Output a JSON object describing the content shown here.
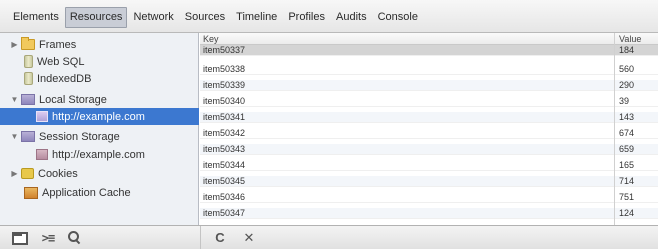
{
  "tabs": [
    {
      "label": "Elements",
      "active": false
    },
    {
      "label": "Resources",
      "active": true
    },
    {
      "label": "Network",
      "active": false
    },
    {
      "label": "Sources",
      "active": false
    },
    {
      "label": "Timeline",
      "active": false
    },
    {
      "label": "Profiles",
      "active": false
    },
    {
      "label": "Audits",
      "active": false
    },
    {
      "label": "Console",
      "active": false
    }
  ],
  "sidebar": {
    "items": [
      {
        "label": "Frames",
        "icon": "folder-icon",
        "expander": "collapsed"
      },
      {
        "label": "Web SQL",
        "icon": "database-icon",
        "expander": "none"
      },
      {
        "label": "IndexedDB",
        "icon": "database-icon",
        "expander": "none"
      },
      {
        "label": "Local Storage",
        "icon": "storage-icon",
        "expander": "expanded"
      },
      {
        "label": "http://example.com",
        "icon": "page-icon",
        "expander": "none",
        "selected": true
      },
      {
        "label": "Session Storage",
        "icon": "storage-icon",
        "expander": "expanded"
      },
      {
        "label": "http://example.com",
        "icon": "page-icon",
        "expander": "none"
      },
      {
        "label": "Cookies",
        "icon": "cookie-icon",
        "expander": "collapsed"
      },
      {
        "label": "Application Cache",
        "icon": "app-cache-icon",
        "expander": "none"
      }
    ]
  },
  "grid": {
    "columns": {
      "key": "Key",
      "value": "Value"
    },
    "rows": [
      {
        "key": "item50337",
        "value": "184"
      },
      {
        "key": "item50338",
        "value": "560"
      },
      {
        "key": "item50339",
        "value": "290"
      },
      {
        "key": "item50340",
        "value": "39"
      },
      {
        "key": "item50341",
        "value": "143"
      },
      {
        "key": "item50342",
        "value": "674"
      },
      {
        "key": "item50343",
        "value": "659"
      },
      {
        "key": "item50344",
        "value": "165"
      },
      {
        "key": "item50345",
        "value": "714"
      },
      {
        "key": "item50346",
        "value": "751"
      },
      {
        "key": "item50347",
        "value": "124"
      }
    ],
    "selected_row": 0
  },
  "statusbar": {
    "left_icons": [
      "dock-icon",
      "console-drawer-icon",
      "search-icon"
    ],
    "right_icons": [
      "refresh-icon",
      "clear-icon"
    ],
    "console_glyph": ">≡",
    "refresh_glyph": "C",
    "clear_glyph": "✕"
  },
  "colors": {
    "selection_blue": "#3c78d0",
    "active_tab": "#c9cdd6",
    "sidebar_bg": "#eef1f5"
  }
}
